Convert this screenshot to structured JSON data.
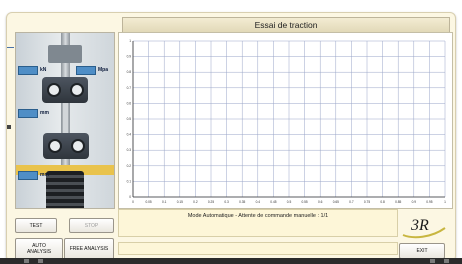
{
  "window": {
    "title": "Essai de traction"
  },
  "readouts": [
    {
      "label": "kN"
    },
    {
      "label": "Mpa"
    },
    {
      "label": "mm"
    },
    {
      "label": "mm"
    }
  ],
  "status": {
    "message": "Mode Automatique - Attente de commande manuelle : 1/1"
  },
  "buttons": {
    "test": "TEST",
    "stop": "STOP",
    "auto_analysis_line1": "AUTO",
    "auto_analysis_line2": "ANALYSIS",
    "free_analysis": "FREE ANALYSIS",
    "exit": "EXIT"
  },
  "logo_text": "3R",
  "chart_data": {
    "type": "line",
    "title": "",
    "xlabel": "",
    "ylabel": "",
    "series": [],
    "x_ticks": [
      "0",
      "0.05",
      "0.1",
      "0.15",
      "0.2",
      "0.25",
      "0.3",
      "0.35",
      "0.4",
      "0.45",
      "0.5",
      "0.55",
      "0.6",
      "0.65",
      "0.7",
      "0.75",
      "0.8",
      "0.85",
      "0.9",
      "0.95",
      "1"
    ],
    "y_ticks": [
      "0",
      "0.1",
      "0.2",
      "0.3",
      "0.4",
      "0.5",
      "0.6",
      "0.7",
      "0.8",
      "0.9",
      "1"
    ],
    "xlim": [
      0,
      1
    ],
    "ylim": [
      0,
      1
    ],
    "grid": true,
    "grid_color": "#9aa6c8"
  }
}
